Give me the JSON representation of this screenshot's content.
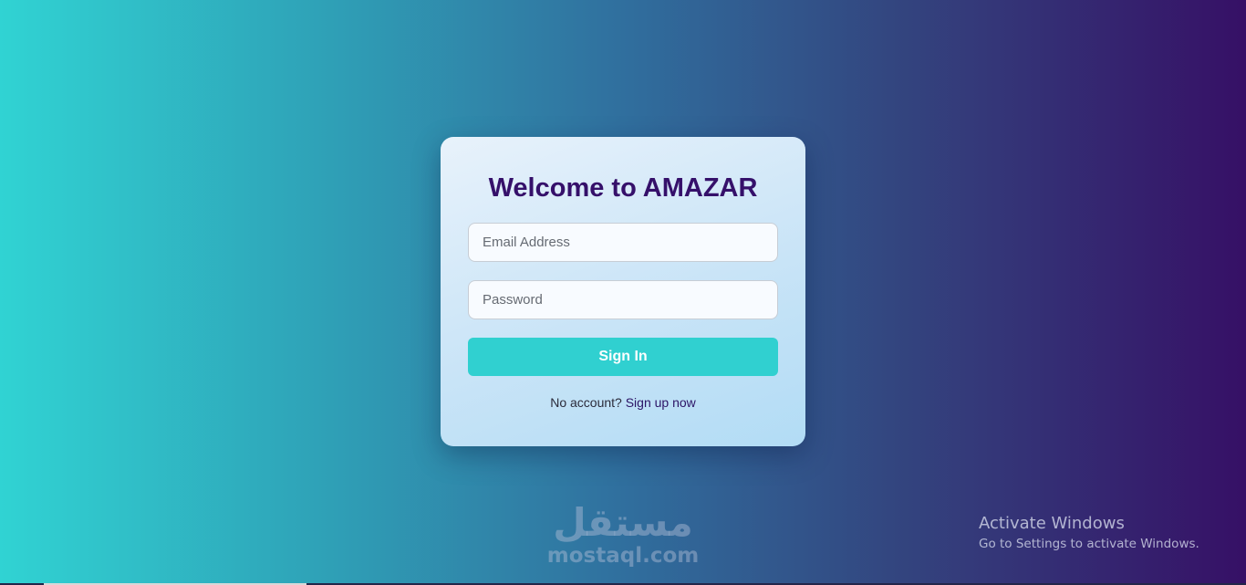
{
  "login_card": {
    "title": "Welcome to AMAZAR",
    "email": {
      "placeholder": "Email Address",
      "value": ""
    },
    "password": {
      "placeholder": "Password",
      "value": ""
    },
    "signin_label": "Sign In",
    "signup_prompt": "No account?",
    "signup_link": "Sign up now"
  },
  "watermark": {
    "arabic": "مستقل",
    "latin": "mostaql.com"
  },
  "windows_notice": {
    "title": "Activate Windows",
    "subtitle": "Go to Settings to activate Windows."
  },
  "colors": {
    "gradient_left": "#30d3d3",
    "gradient_right": "#361066",
    "title": "#35106a",
    "button": "#30d0d0",
    "link": "#2c1466"
  }
}
